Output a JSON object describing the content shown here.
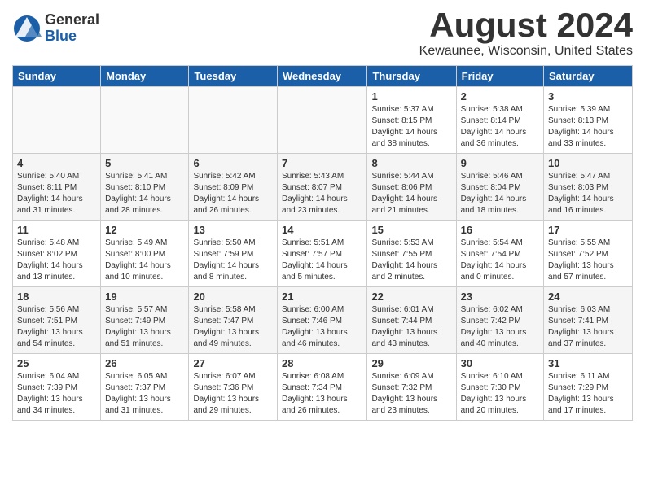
{
  "logo": {
    "general": "General",
    "blue": "Blue"
  },
  "title": {
    "month_year": "August 2024",
    "location": "Kewaunee, Wisconsin, United States"
  },
  "weekdays": [
    "Sunday",
    "Monday",
    "Tuesday",
    "Wednesday",
    "Thursday",
    "Friday",
    "Saturday"
  ],
  "weeks": [
    [
      {
        "day": "",
        "info": ""
      },
      {
        "day": "",
        "info": ""
      },
      {
        "day": "",
        "info": ""
      },
      {
        "day": "",
        "info": ""
      },
      {
        "day": "1",
        "info": "Sunrise: 5:37 AM\nSunset: 8:15 PM\nDaylight: 14 hours\nand 38 minutes."
      },
      {
        "day": "2",
        "info": "Sunrise: 5:38 AM\nSunset: 8:14 PM\nDaylight: 14 hours\nand 36 minutes."
      },
      {
        "day": "3",
        "info": "Sunrise: 5:39 AM\nSunset: 8:13 PM\nDaylight: 14 hours\nand 33 minutes."
      }
    ],
    [
      {
        "day": "4",
        "info": "Sunrise: 5:40 AM\nSunset: 8:11 PM\nDaylight: 14 hours\nand 31 minutes."
      },
      {
        "day": "5",
        "info": "Sunrise: 5:41 AM\nSunset: 8:10 PM\nDaylight: 14 hours\nand 28 minutes."
      },
      {
        "day": "6",
        "info": "Sunrise: 5:42 AM\nSunset: 8:09 PM\nDaylight: 14 hours\nand 26 minutes."
      },
      {
        "day": "7",
        "info": "Sunrise: 5:43 AM\nSunset: 8:07 PM\nDaylight: 14 hours\nand 23 minutes."
      },
      {
        "day": "8",
        "info": "Sunrise: 5:44 AM\nSunset: 8:06 PM\nDaylight: 14 hours\nand 21 minutes."
      },
      {
        "day": "9",
        "info": "Sunrise: 5:46 AM\nSunset: 8:04 PM\nDaylight: 14 hours\nand 18 minutes."
      },
      {
        "day": "10",
        "info": "Sunrise: 5:47 AM\nSunset: 8:03 PM\nDaylight: 14 hours\nand 16 minutes."
      }
    ],
    [
      {
        "day": "11",
        "info": "Sunrise: 5:48 AM\nSunset: 8:02 PM\nDaylight: 14 hours\nand 13 minutes."
      },
      {
        "day": "12",
        "info": "Sunrise: 5:49 AM\nSunset: 8:00 PM\nDaylight: 14 hours\nand 10 minutes."
      },
      {
        "day": "13",
        "info": "Sunrise: 5:50 AM\nSunset: 7:59 PM\nDaylight: 14 hours\nand 8 minutes."
      },
      {
        "day": "14",
        "info": "Sunrise: 5:51 AM\nSunset: 7:57 PM\nDaylight: 14 hours\nand 5 minutes."
      },
      {
        "day": "15",
        "info": "Sunrise: 5:53 AM\nSunset: 7:55 PM\nDaylight: 14 hours\nand 2 minutes."
      },
      {
        "day": "16",
        "info": "Sunrise: 5:54 AM\nSunset: 7:54 PM\nDaylight: 14 hours\nand 0 minutes."
      },
      {
        "day": "17",
        "info": "Sunrise: 5:55 AM\nSunset: 7:52 PM\nDaylight: 13 hours\nand 57 minutes."
      }
    ],
    [
      {
        "day": "18",
        "info": "Sunrise: 5:56 AM\nSunset: 7:51 PM\nDaylight: 13 hours\nand 54 minutes."
      },
      {
        "day": "19",
        "info": "Sunrise: 5:57 AM\nSunset: 7:49 PM\nDaylight: 13 hours\nand 51 minutes."
      },
      {
        "day": "20",
        "info": "Sunrise: 5:58 AM\nSunset: 7:47 PM\nDaylight: 13 hours\nand 49 minutes."
      },
      {
        "day": "21",
        "info": "Sunrise: 6:00 AM\nSunset: 7:46 PM\nDaylight: 13 hours\nand 46 minutes."
      },
      {
        "day": "22",
        "info": "Sunrise: 6:01 AM\nSunset: 7:44 PM\nDaylight: 13 hours\nand 43 minutes."
      },
      {
        "day": "23",
        "info": "Sunrise: 6:02 AM\nSunset: 7:42 PM\nDaylight: 13 hours\nand 40 minutes."
      },
      {
        "day": "24",
        "info": "Sunrise: 6:03 AM\nSunset: 7:41 PM\nDaylight: 13 hours\nand 37 minutes."
      }
    ],
    [
      {
        "day": "25",
        "info": "Sunrise: 6:04 AM\nSunset: 7:39 PM\nDaylight: 13 hours\nand 34 minutes."
      },
      {
        "day": "26",
        "info": "Sunrise: 6:05 AM\nSunset: 7:37 PM\nDaylight: 13 hours\nand 31 minutes."
      },
      {
        "day": "27",
        "info": "Sunrise: 6:07 AM\nSunset: 7:36 PM\nDaylight: 13 hours\nand 29 minutes."
      },
      {
        "day": "28",
        "info": "Sunrise: 6:08 AM\nSunset: 7:34 PM\nDaylight: 13 hours\nand 26 minutes."
      },
      {
        "day": "29",
        "info": "Sunrise: 6:09 AM\nSunset: 7:32 PM\nDaylight: 13 hours\nand 23 minutes."
      },
      {
        "day": "30",
        "info": "Sunrise: 6:10 AM\nSunset: 7:30 PM\nDaylight: 13 hours\nand 20 minutes."
      },
      {
        "day": "31",
        "info": "Sunrise: 6:11 AM\nSunset: 7:29 PM\nDaylight: 13 hours\nand 17 minutes."
      }
    ]
  ]
}
